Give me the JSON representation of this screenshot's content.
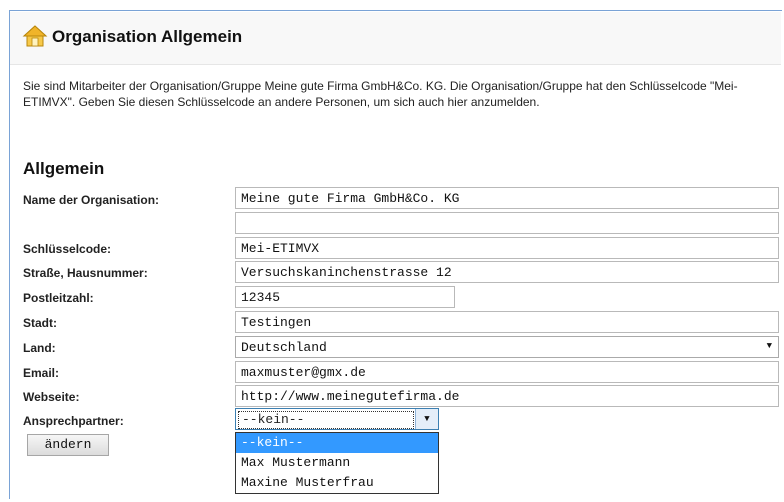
{
  "page": {
    "title": "Organisation Allgemein",
    "intro": "Sie sind Mitarbeiter der Organisation/Gruppe Meine gute Firma GmbH&Co. KG. Die Organisation/Gruppe hat den Schlüsselcode \"Mei-ETIMVX\". Geben Sie diesen Schlüsselcode an andere Personen, um sich auch hier anzumelden.",
    "section_title": "Allgemein"
  },
  "form": {
    "name_label": "Name der Organisation:",
    "name_value": "Meine gute Firma GmbH&Co. KG",
    "name_value_2": "",
    "code_label": "Schlüsselcode:",
    "code_value": "Mei-ETIMVX",
    "street_label": "Straße, Hausnummer:",
    "street_value": "Versuchskaninchenstrasse 12",
    "zip_label": "Postleitzahl:",
    "zip_value": "12345",
    "city_label": "Stadt:",
    "city_value": "Testingen",
    "country_label": "Land:",
    "country_value": "Deutschland",
    "email_label": "Email:",
    "email_value": "maxmuster@gmx.de",
    "website_label": "Webseite:",
    "website_value": "http://www.meinegutefirma.de",
    "contact_label": "Ansprechpartner:",
    "contact_value": "--kein--",
    "contact_options": [
      "--kein--",
      "Max Mustermann",
      "Maxine Musterfrau"
    ],
    "submit_label": "ändern"
  },
  "icons": {
    "title_icon": "home-icon",
    "dropdown_arrow": "chevron-down-icon"
  },
  "colors": {
    "selected_option": "#3399ff",
    "frame_border": "#7aa3d6"
  }
}
